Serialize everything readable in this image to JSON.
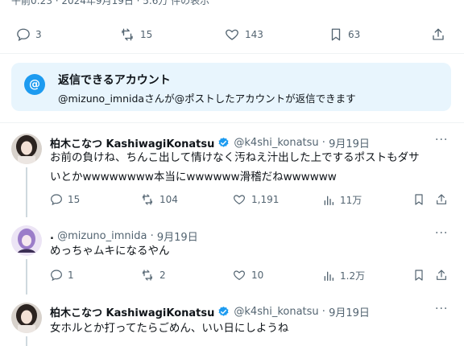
{
  "top_fragment": "午前0:23 · 2024年9月19日 · 5.6万 件の表示",
  "main_actions": {
    "replies": "3",
    "reposts": "15",
    "likes": "143",
    "bookmarks": "63"
  },
  "reply_restriction": {
    "title": "返信できるアカウント",
    "description": "@mizuno_imnidaさんが@ポストしたアカウントが返信できます",
    "badge": "@"
  },
  "replies": [
    {
      "name": "柏木こなつ KashiwagiKonatsu",
      "verified": true,
      "handle": "@k4shi_konatsu",
      "date": "9月19日",
      "text_lines": [
        "お前の負けね、ちんこ出して情けなく汚ねえ汁出した上でするポストもダサ",
        "いとかwwwwwwww本当にwwwwww滑稽だねwwwwww"
      ],
      "replies": "15",
      "reposts": "104",
      "likes": "1,191",
      "views": "11万"
    },
    {
      "name": ".",
      "verified": false,
      "handle": "@mizuno_imnida",
      "date": "9月19日",
      "text_lines": [
        "めっちゃムキになるやん"
      ],
      "replies": "1",
      "reposts": "2",
      "likes": "10",
      "views": "1.2万"
    },
    {
      "name": "柏木こなつ KashiwagiKonatsu",
      "verified": true,
      "handle": "@k4shi_konatsu",
      "date": "9月19日",
      "text_lines": [
        "女ホルとか打ってたらごめん、いい日にしようね"
      ]
    }
  ],
  "colors": {
    "accent": "#1d9bf0",
    "card_bg": "#e8f5fd",
    "muted": "#536471",
    "text": "#0f1419"
  }
}
